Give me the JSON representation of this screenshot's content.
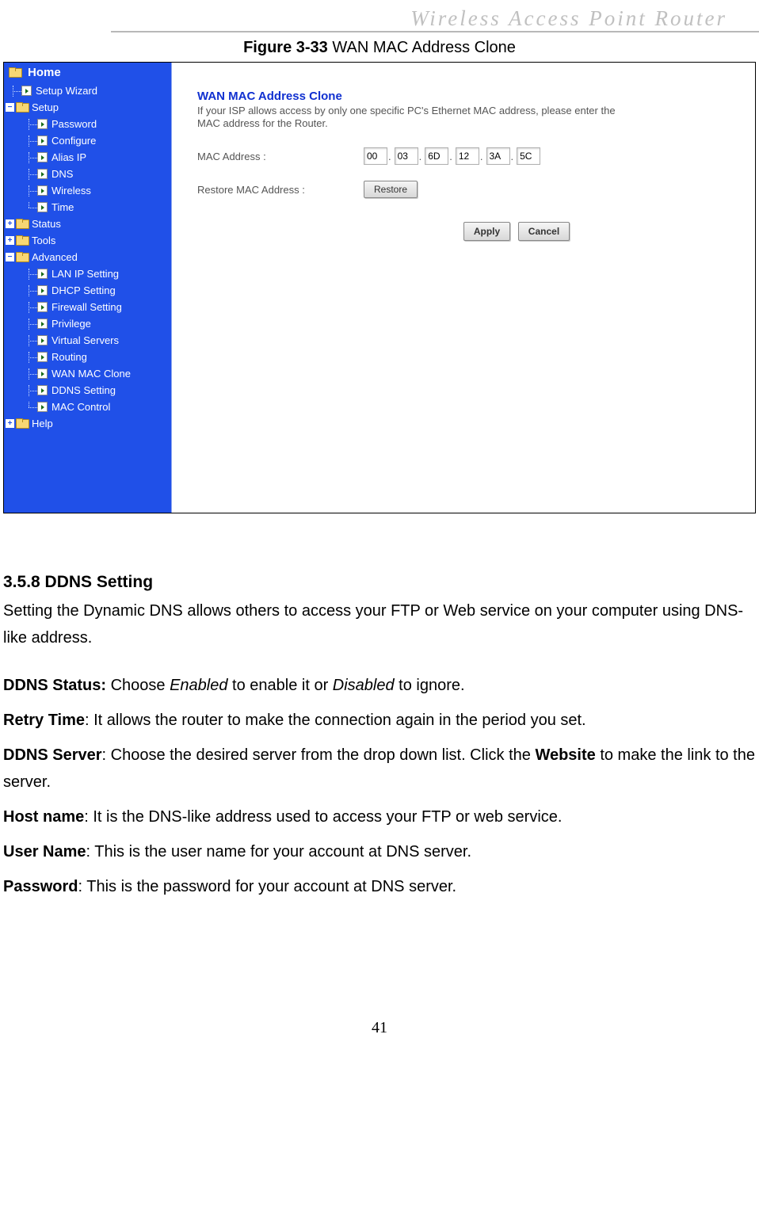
{
  "header": "Wireless  Access  Point  Router",
  "figure": {
    "label": "Figure 3-33",
    "title": "WAN MAC Address Clone"
  },
  "sidebar": {
    "root": "Home",
    "groups": [
      {
        "label": "Setup Wizard",
        "type": "leaf"
      },
      {
        "label": "Setup",
        "type": "folder",
        "open": true,
        "children": [
          "Password",
          "Configure",
          "Alias IP",
          "DNS",
          "Wireless",
          "Time"
        ]
      },
      {
        "label": "Status",
        "type": "folder",
        "open": false
      },
      {
        "label": "Tools",
        "type": "folder",
        "open": false
      },
      {
        "label": "Advanced",
        "type": "folder",
        "open": true,
        "children": [
          "LAN IP Setting",
          "DHCP Setting",
          "Firewall Setting",
          "Privilege",
          "Virtual Servers",
          "Routing",
          "WAN MAC Clone",
          "DDNS Setting",
          "MAC Control"
        ]
      },
      {
        "label": "Help",
        "type": "folder",
        "open": false
      }
    ]
  },
  "panel": {
    "title": "WAN MAC Address Clone",
    "desc": "If your ISP allows access by only one specific PC's Ethernet MAC address, please enter the MAC address for the Router.",
    "mac_label": "MAC Address :",
    "mac": [
      "00",
      "03",
      "6D",
      "12",
      "3A",
      "5C"
    ],
    "restore_label": "Restore MAC Address :",
    "restore_btn": "Restore",
    "apply_btn": "Apply",
    "cancel_btn": "Cancel"
  },
  "doc": {
    "section_title": "3.5.8 DDNS Setting",
    "intro": "Setting the Dynamic DNS allows others to access your FTP or Web service on your computer using DNS-like address.",
    "items": [
      {
        "bold": "DDNS Status:",
        "text_before": " Choose ",
        "em1": "Enabled",
        "mid": " to enable it or ",
        "em2": "Disabled",
        "after": " to ignore."
      },
      {
        "bold": "Retry Time",
        "text": ": It allows the router to make the connection again in the period you set."
      },
      {
        "bold": "DDNS Server",
        "text_before": ": Choose the desired server from the drop down list. Click the ",
        "bold2": "Website",
        "after": " to make the link to the server."
      },
      {
        "bold": "Host name",
        "text": ": It is the DNS-like address used to access your FTP or web service."
      },
      {
        "bold": "User Name",
        "text": ": This is the user name for your account at DNS server."
      },
      {
        "bold": "Password",
        "text": ": This is the password for your account at DNS server."
      }
    ]
  },
  "page_number": "41"
}
